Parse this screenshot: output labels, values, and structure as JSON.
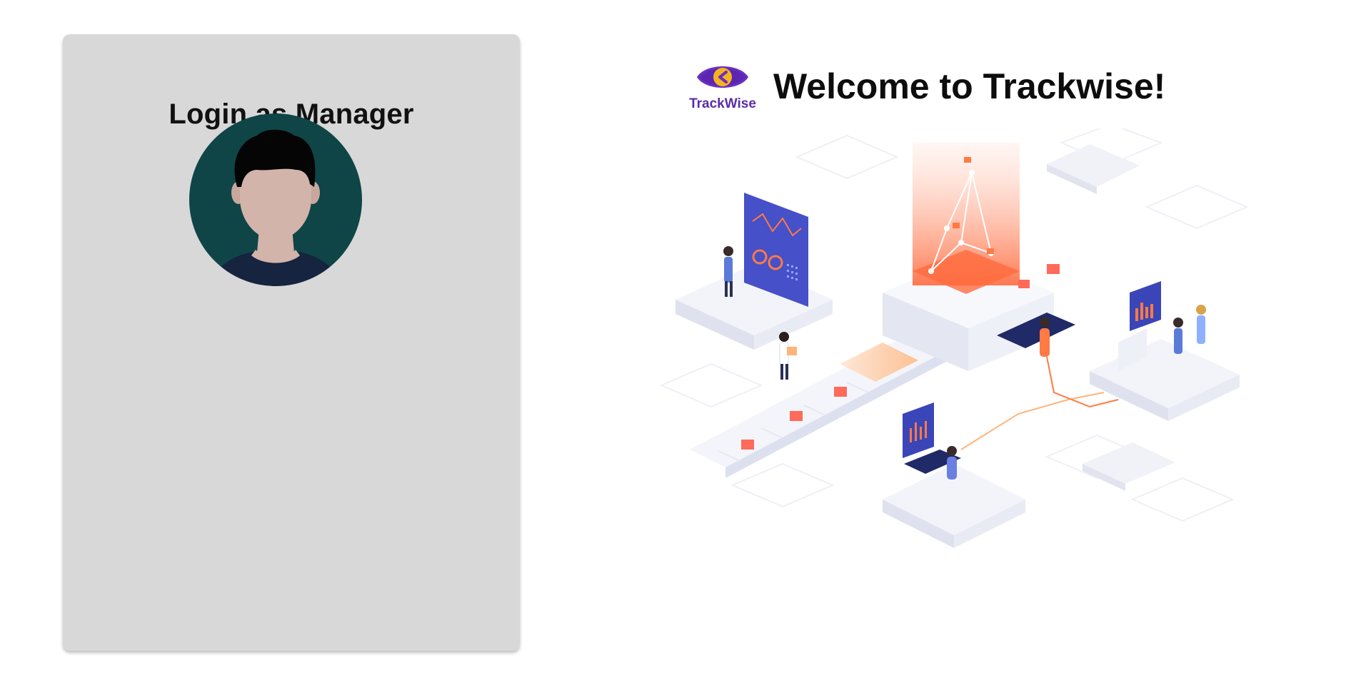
{
  "login": {
    "title": "Login as Manager",
    "avatar_icon": "user-avatar-icon"
  },
  "brand": {
    "logo_icon": "eye-logo-icon",
    "name": "TrackWise",
    "color": "#5b2ca8"
  },
  "welcome": {
    "title": "Welcome to Trackwise!"
  },
  "hero": {
    "illustration": "isometric-data-platform-illustration"
  },
  "colors": {
    "card_background": "#d8d8d8",
    "avatar_background": "#0f4547",
    "accent_orange": "#ff7a45",
    "accent_indigo": "#4b4fd1"
  }
}
